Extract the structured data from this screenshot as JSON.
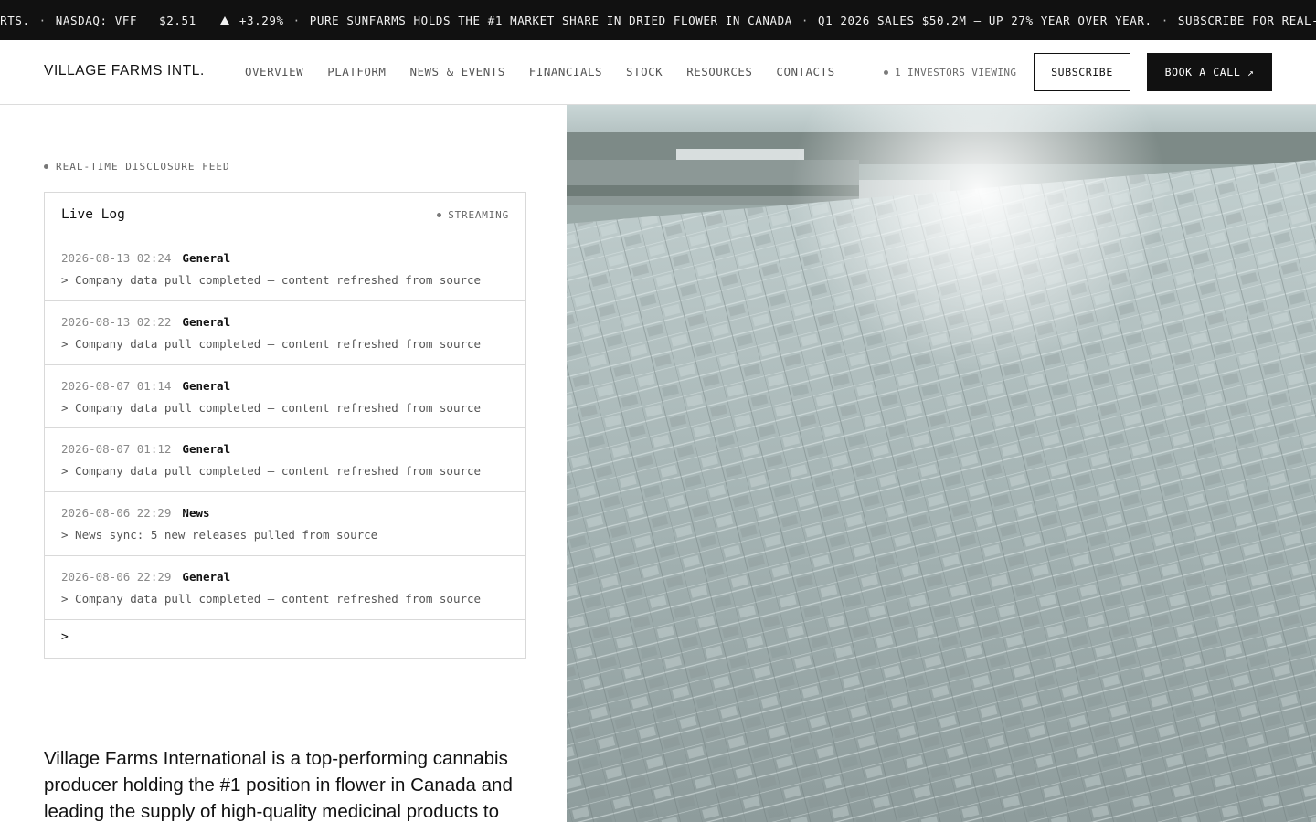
{
  "ticker": {
    "prefix": "ERTS.",
    "symbol": "NASDAQ: VFF",
    "price": "$2.51",
    "change": "+3.29%",
    "headline1": "PURE SUNFARMS HOLDS THE #1 MARKET SHARE IN DRIED FLOWER IN CANADA",
    "headline2": "Q1 2026 SALES $50.2M — UP 27% YEAR OVER YEAR.",
    "headline3": "SUBSCRIBE FOR REAL-TIME ALE",
    "separator": "·"
  },
  "header": {
    "brand": "VILLAGE FARMS INTL.",
    "nav": [
      "OVERVIEW",
      "PLATFORM",
      "NEWS & EVENTS",
      "FINANCIALS",
      "STOCK",
      "RESOURCES",
      "CONTACTS"
    ],
    "viewers": "1 INVESTORS VIEWING",
    "subscribe": "SUBSCRIBE",
    "book_call": "BOOK A CALL ↗"
  },
  "feed": {
    "label": "REAL-TIME DISCLOSURE FEED",
    "title": "Live Log",
    "status": "STREAMING",
    "entries": [
      {
        "time": "2026-08-13 02:24",
        "category": "General",
        "message": "> Company data pull completed — content refreshed from source"
      },
      {
        "time": "2026-08-13 02:22",
        "category": "General",
        "message": "> Company data pull completed — content refreshed from source"
      },
      {
        "time": "2026-08-07 01:14",
        "category": "General",
        "message": "> Company data pull completed — content refreshed from source"
      },
      {
        "time": "2026-08-07 01:12",
        "category": "General",
        "message": "> Company data pull completed — content refreshed from source"
      },
      {
        "time": "2026-08-06 22:29",
        "category": "News",
        "message": "> News sync: 5 new releases pulled from source"
      },
      {
        "time": "2026-08-06 22:29",
        "category": "General",
        "message": "> Company data pull completed — content refreshed from source"
      }
    ],
    "prompt": ">"
  },
  "intro": "Village Farms International is a top-performing cannabis producer holding the #1 position in flower in Canada and leading the supply of high-quality medicinal products to",
  "colors": {
    "ink": "#111111",
    "muted": "#666666",
    "border": "#d9d9d9",
    "glass": "#b9c6c6"
  }
}
